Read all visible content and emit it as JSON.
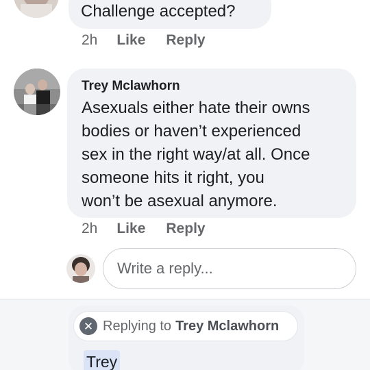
{
  "top_comment": {
    "text": "Challenge accepted?",
    "time": "2h",
    "like_label": "Like",
    "reply_label": "Reply"
  },
  "comment": {
    "author": "Trey Mclawhorn",
    "text_lines": [
      "Asexuals either hate their owns",
      "bodies or haven’t experienced",
      "sex in the right way/at all. Once",
      "someone hits it right, you",
      "won’t be asexual anymore."
    ],
    "time": "2h",
    "like_label": "Like",
    "reply_label": "Reply"
  },
  "reply_box": {
    "placeholder": "Write a reply..."
  },
  "composer": {
    "replying_prefix": "Replying to",
    "replying_name": "Trey Mclawhorn",
    "close_icon": "close-icon",
    "mention_text": "Trey"
  },
  "colors": {
    "bubble": "#f0f2f5",
    "meta_text": "#65676b",
    "mention_highlight": "#dbe4f7"
  }
}
